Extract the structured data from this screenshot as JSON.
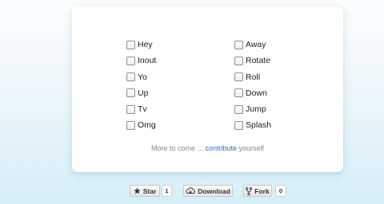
{
  "options": {
    "left": [
      "Hey",
      "Inout",
      "Yo",
      "Up",
      "Tv",
      "Omg"
    ],
    "right": [
      "Away",
      "Rotate",
      "Roll",
      "Down",
      "Jump",
      "Splash"
    ]
  },
  "footer": {
    "prefix": "More to come ...",
    "link": "contribute",
    "suffix": "yourself"
  },
  "github": {
    "star_label": "Star",
    "star_count": "1",
    "download_label": "Download",
    "fork_label": "Fork",
    "fork_count": "0"
  },
  "colors": {
    "link": "#2473c5",
    "footer_text": "#7d8a95"
  },
  "icons": {
    "star": "star-icon",
    "download": "cloud-download-icon",
    "fork": "fork-icon"
  }
}
